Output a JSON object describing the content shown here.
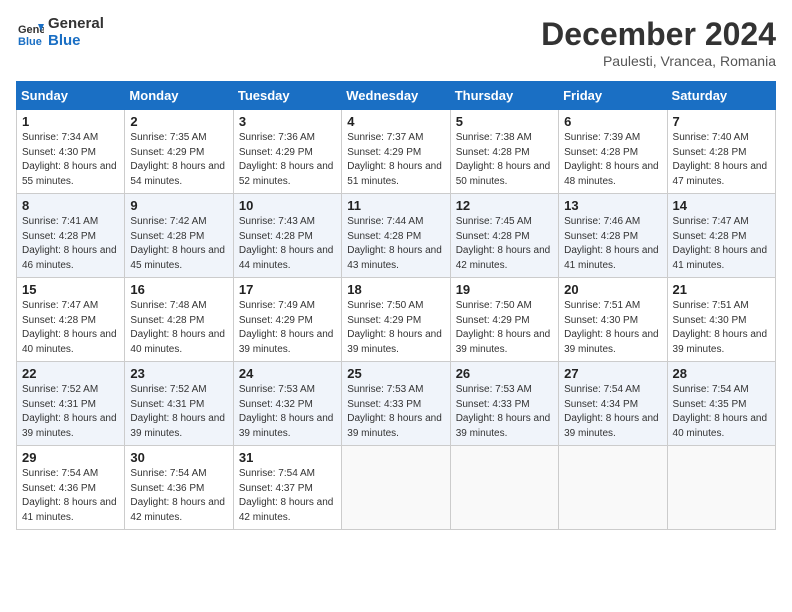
{
  "header": {
    "logo_line1": "General",
    "logo_line2": "Blue",
    "month_title": "December 2024",
    "location": "Paulesti, Vrancea, Romania"
  },
  "weekdays": [
    "Sunday",
    "Monday",
    "Tuesday",
    "Wednesday",
    "Thursday",
    "Friday",
    "Saturday"
  ],
  "weeks": [
    [
      {
        "day": "1",
        "sunrise": "7:34 AM",
        "sunset": "4:30 PM",
        "daylight": "8 hours and 55 minutes."
      },
      {
        "day": "2",
        "sunrise": "7:35 AM",
        "sunset": "4:29 PM",
        "daylight": "8 hours and 54 minutes."
      },
      {
        "day": "3",
        "sunrise": "7:36 AM",
        "sunset": "4:29 PM",
        "daylight": "8 hours and 52 minutes."
      },
      {
        "day": "4",
        "sunrise": "7:37 AM",
        "sunset": "4:29 PM",
        "daylight": "8 hours and 51 minutes."
      },
      {
        "day": "5",
        "sunrise": "7:38 AM",
        "sunset": "4:28 PM",
        "daylight": "8 hours and 50 minutes."
      },
      {
        "day": "6",
        "sunrise": "7:39 AM",
        "sunset": "4:28 PM",
        "daylight": "8 hours and 48 minutes."
      },
      {
        "day": "7",
        "sunrise": "7:40 AM",
        "sunset": "4:28 PM",
        "daylight": "8 hours and 47 minutes."
      }
    ],
    [
      {
        "day": "8",
        "sunrise": "7:41 AM",
        "sunset": "4:28 PM",
        "daylight": "8 hours and 46 minutes."
      },
      {
        "day": "9",
        "sunrise": "7:42 AM",
        "sunset": "4:28 PM",
        "daylight": "8 hours and 45 minutes."
      },
      {
        "day": "10",
        "sunrise": "7:43 AM",
        "sunset": "4:28 PM",
        "daylight": "8 hours and 44 minutes."
      },
      {
        "day": "11",
        "sunrise": "7:44 AM",
        "sunset": "4:28 PM",
        "daylight": "8 hours and 43 minutes."
      },
      {
        "day": "12",
        "sunrise": "7:45 AM",
        "sunset": "4:28 PM",
        "daylight": "8 hours and 42 minutes."
      },
      {
        "day": "13",
        "sunrise": "7:46 AM",
        "sunset": "4:28 PM",
        "daylight": "8 hours and 41 minutes."
      },
      {
        "day": "14",
        "sunrise": "7:47 AM",
        "sunset": "4:28 PM",
        "daylight": "8 hours and 41 minutes."
      }
    ],
    [
      {
        "day": "15",
        "sunrise": "7:47 AM",
        "sunset": "4:28 PM",
        "daylight": "8 hours and 40 minutes."
      },
      {
        "day": "16",
        "sunrise": "7:48 AM",
        "sunset": "4:28 PM",
        "daylight": "8 hours and 40 minutes."
      },
      {
        "day": "17",
        "sunrise": "7:49 AM",
        "sunset": "4:29 PM",
        "daylight": "8 hours and 39 minutes."
      },
      {
        "day": "18",
        "sunrise": "7:50 AM",
        "sunset": "4:29 PM",
        "daylight": "8 hours and 39 minutes."
      },
      {
        "day": "19",
        "sunrise": "7:50 AM",
        "sunset": "4:29 PM",
        "daylight": "8 hours and 39 minutes."
      },
      {
        "day": "20",
        "sunrise": "7:51 AM",
        "sunset": "4:30 PM",
        "daylight": "8 hours and 39 minutes."
      },
      {
        "day": "21",
        "sunrise": "7:51 AM",
        "sunset": "4:30 PM",
        "daylight": "8 hours and 39 minutes."
      }
    ],
    [
      {
        "day": "22",
        "sunrise": "7:52 AM",
        "sunset": "4:31 PM",
        "daylight": "8 hours and 39 minutes."
      },
      {
        "day": "23",
        "sunrise": "7:52 AM",
        "sunset": "4:31 PM",
        "daylight": "8 hours and 39 minutes."
      },
      {
        "day": "24",
        "sunrise": "7:53 AM",
        "sunset": "4:32 PM",
        "daylight": "8 hours and 39 minutes."
      },
      {
        "day": "25",
        "sunrise": "7:53 AM",
        "sunset": "4:33 PM",
        "daylight": "8 hours and 39 minutes."
      },
      {
        "day": "26",
        "sunrise": "7:53 AM",
        "sunset": "4:33 PM",
        "daylight": "8 hours and 39 minutes."
      },
      {
        "day": "27",
        "sunrise": "7:54 AM",
        "sunset": "4:34 PM",
        "daylight": "8 hours and 39 minutes."
      },
      {
        "day": "28",
        "sunrise": "7:54 AM",
        "sunset": "4:35 PM",
        "daylight": "8 hours and 40 minutes."
      }
    ],
    [
      {
        "day": "29",
        "sunrise": "7:54 AM",
        "sunset": "4:36 PM",
        "daylight": "8 hours and 41 minutes."
      },
      {
        "day": "30",
        "sunrise": "7:54 AM",
        "sunset": "4:36 PM",
        "daylight": "8 hours and 42 minutes."
      },
      {
        "day": "31",
        "sunrise": "7:54 AM",
        "sunset": "4:37 PM",
        "daylight": "8 hours and 42 minutes."
      },
      null,
      null,
      null,
      null
    ]
  ],
  "labels": {
    "sunrise": "Sunrise: ",
    "sunset": "Sunset: ",
    "daylight": "Daylight: "
  }
}
